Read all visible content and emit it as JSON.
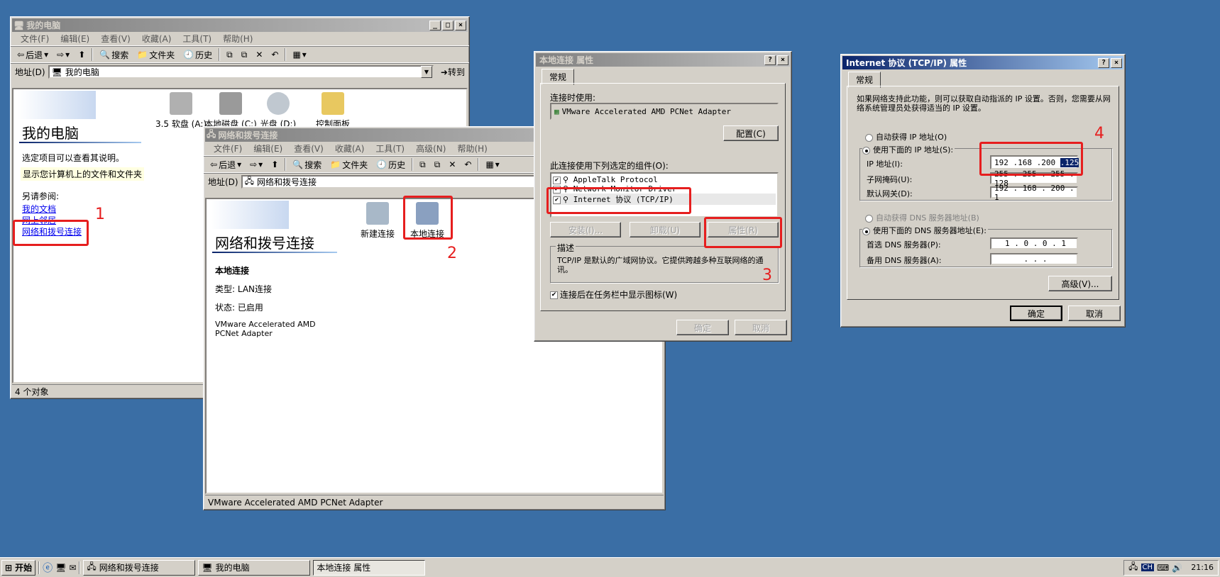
{
  "mycomputer": {
    "title": "我的电脑",
    "menu": [
      "文件(F)",
      "编辑(E)",
      "查看(V)",
      "收藏(A)",
      "工具(T)",
      "帮助(H)"
    ],
    "toolbar": {
      "back": "后退",
      "search": "搜索",
      "folders": "文件夹",
      "history": "历史"
    },
    "address_label": "地址(D)",
    "address_value": "我的电脑",
    "go": "转到",
    "heading": "我的电脑",
    "desc": "选定项目可以查看其说明。",
    "tip": "显示您计算机上的文件和文件夹",
    "see_also": "另请参阅:",
    "links": [
      "我的文档",
      "网上邻居",
      "网络和拨号连接"
    ],
    "icons": [
      "3.5 软盘 (A:)",
      "本地磁盘 (C:)",
      "光盘 (D:)",
      "控制面板"
    ],
    "status": "4 个对象"
  },
  "netconn": {
    "title": "网络和拨号连接",
    "menu": [
      "文件(F)",
      "编辑(E)",
      "查看(V)",
      "收藏(A)",
      "工具(T)",
      "高级(N)",
      "帮助(H)"
    ],
    "toolbar": {
      "back": "后退",
      "search": "搜索",
      "folders": "文件夹",
      "history": "历史"
    },
    "address_label": "地址(D)",
    "address_value": "网络和拨号连接",
    "heading": "网络和拨号连接",
    "icons": [
      "新建连接",
      "本地连接"
    ],
    "detail_title": "本地连接",
    "type": "类型: LAN连接",
    "state": "状态: 已启用",
    "adapter": "VMware Accelerated AMD PCNet Adapter",
    "status": "VMware Accelerated AMD PCNet Adapter"
  },
  "localprops": {
    "title": "本地连接 属性",
    "tab": "常规",
    "connect_using": "连接时使用:",
    "adapter": "VMware Accelerated AMD PCNet Adapter",
    "configure": "配置(C)",
    "components_label": "此连接使用下列选定的组件(O):",
    "components": [
      "AppleTalk Protocol",
      "Network Monitor Driver",
      "Internet 协议 (TCP/IP)"
    ],
    "install": "安装(I)...",
    "uninstall": "卸载(U)",
    "properties": "属性(R)",
    "desc_label": "描述",
    "desc_text": "TCP/IP 是默认的广域网协议。它提供跨越多种互联网络的通讯。",
    "show_icon": "连接后在任务栏中显示图标(W)",
    "ok": "确定",
    "cancel": "取消"
  },
  "tcpip": {
    "title": "Internet 协议 (TCP/IP) 属性",
    "tab": "常规",
    "info": "如果网络支持此功能，则可以获取自动指派的 IP 设置。否则，您需要从网络系统管理员处获得适当的 IP 设置。",
    "auto_ip": "自动获得 IP 地址(O)",
    "use_ip": "使用下面的 IP 地址(S):",
    "ip_label": "IP 地址(I):",
    "ip_value": [
      "192",
      ".168",
      ".200",
      ".125"
    ],
    "mask_label": "子网掩码(U):",
    "mask_value": "255 . 255 . 255 . 128",
    "gw_label": "默认网关(D):",
    "gw_value": "192 . 168 . 200 . 1",
    "auto_dns": "自动获得 DNS 服务器地址(B)",
    "use_dns": "使用下面的 DNS 服务器地址(E):",
    "dns1_label": "首选 DNS 服务器(P):",
    "dns1_value": "1 . 0 . 0 . 1",
    "dns2_label": "备用 DNS 服务器(A):",
    "dns2_value": ".       .       .",
    "advanced": "高级(V)...",
    "ok": "确定",
    "cancel": "取消"
  },
  "annotations": [
    "1",
    "2",
    "3",
    "4"
  ],
  "taskbar": {
    "start": "开始",
    "items": [
      "网络和拨号连接",
      "我的电脑",
      "本地连接 属性"
    ],
    "lang": "CH",
    "clock": "21:16"
  }
}
